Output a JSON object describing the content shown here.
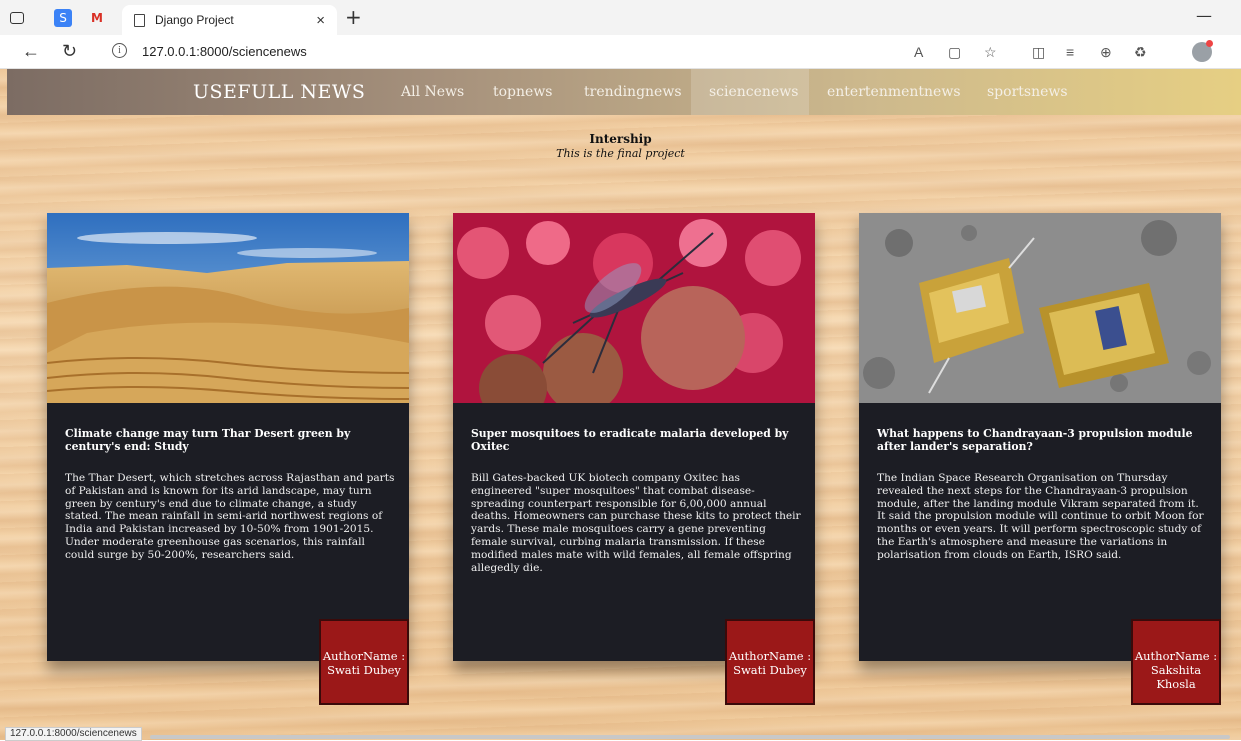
{
  "browser": {
    "tab_title": "Django Project",
    "tab_close": "×",
    "new_tab": "+",
    "minimize": "—",
    "url": "127.0.0.1:8000/sciencenews",
    "status_url": "127.0.0.1:8000/sciencenews"
  },
  "navbar": {
    "brand": "USEFULL NEWS",
    "links": [
      "All News",
      "topnews",
      "trendingnews",
      "sciencenews",
      "entertenmentnews",
      "sportsnews"
    ],
    "active": "sciencenews"
  },
  "banner": {
    "title": "Intership",
    "subtitle": "This is the final project"
  },
  "cards": [
    {
      "title": "Climate change may turn Thar Desert green by century's end: Study",
      "description": "The Thar Desert, which stretches across Rajasthan and parts of Pakistan and is known for its arid landscape, may turn green by century's end due to climate change, a study stated. The mean rainfall in semi-arid northwest regions of India and Pakistan increased by 10-50% from 1901-2015. Under moderate greenhouse gas scenarios, this rainfall could surge by 50-200%, researchers said.",
      "author_label": "AuthorName :",
      "author": "Swati Dubey"
    },
    {
      "title": "Super mosquitoes to eradicate malaria developed by Oxitec",
      "description": "Bill Gates-backed UK biotech company Oxitec has engineered \"super mosquitoes\" that combat disease-spreading counterpart responsible for 6,00,000 annual deaths. Homeowners can purchase these kits to protect their yards. These male mosquitoes carry a gene preventing female survival, curbing malaria transmission. If these modified males mate with wild females, all female offspring allegedly die.",
      "author_label": "AuthorName :",
      "author": "Swati Dubey"
    },
    {
      "title": "What happens to Chandrayaan-3 propulsion module after lander's separation?",
      "description": "The Indian Space Research Organisation on Thursday revealed the next steps for the Chandrayaan-3 propulsion module, after the landing module Vikram separated from it. It said the propulsion module will continue to orbit Moon for months or even years. It will perform spectroscopic study of the Earth's atmosphere and measure the variations in polarisation from clouds on Earth, ISRO said.",
      "author_label": "AuthorName :",
      "author": "Sakshita Khosla"
    }
  ]
}
